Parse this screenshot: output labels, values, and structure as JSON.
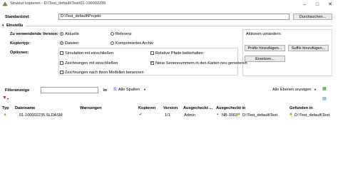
{
  "window": {
    "title": "Struktur kopieren - D:\\Test_default\\Test\\01-100002235",
    "minimize": "–",
    "maximize": "□",
    "close": "✕"
  },
  "target": {
    "label": "Standardziel:",
    "value": "D:\\Test_default\\Projekt",
    "browse_label": "Durchsuchen..."
  },
  "settings": {
    "section_label": "Einstellu",
    "version_label": "Zu verwendende Version:",
    "version_options": [
      "Aktuelle",
      "Referenz"
    ],
    "copytype_label": "Kopiertyp:",
    "copytype_options": [
      "Dateien",
      "Komprimiertes Archiv"
    ],
    "options_label": "Optionen:",
    "options": [
      {
        "label": "Simulation mit einschließen",
        "checked": false
      },
      {
        "label": "Relative Pfade beibehalten",
        "checked": false
      },
      {
        "label": "Zeichnungen mit einschließen",
        "checked": false
      },
      {
        "label": "Neue Seriennummern in den Karten neu generieren",
        "checked": true
      },
      {
        "label": "Zeichnungen nach ihren Modellen benennen",
        "checked": false
      }
    ]
  },
  "actions": {
    "label": "Aktionen umändern:",
    "prefix_button": "Präfix hinzufügen...",
    "suffix_button": "Suffix hinzufügen...",
    "replace_button": "Ersetzen..."
  },
  "filter": {
    "label": "Filteranzeige",
    "in_label": "in",
    "columns_label": "Alle Spalten",
    "levels_label": "Alle Ebenen anzeigen"
  },
  "table": {
    "headers": [
      "Typ",
      "Dateiname",
      "Warnungen",
      "Kopieren",
      "Version",
      "Ausgecheckt ...",
      "Ausgecheckt in",
      "Gefunden in"
    ],
    "rows": [
      {
        "name": "01-100002235.SLDASM",
        "warnings": "",
        "copy": "✔",
        "version": "1/1",
        "checked_out_by": "Admin",
        "checked_out_in": "NB-3003",
        "checked_out_path": "D:\\Test_default\\Test",
        "found_in": "D:\\Test_default\\Test"
      }
    ]
  },
  "colors": {
    "accent": "#2e8b2e",
    "border": "#9a9a9a"
  }
}
